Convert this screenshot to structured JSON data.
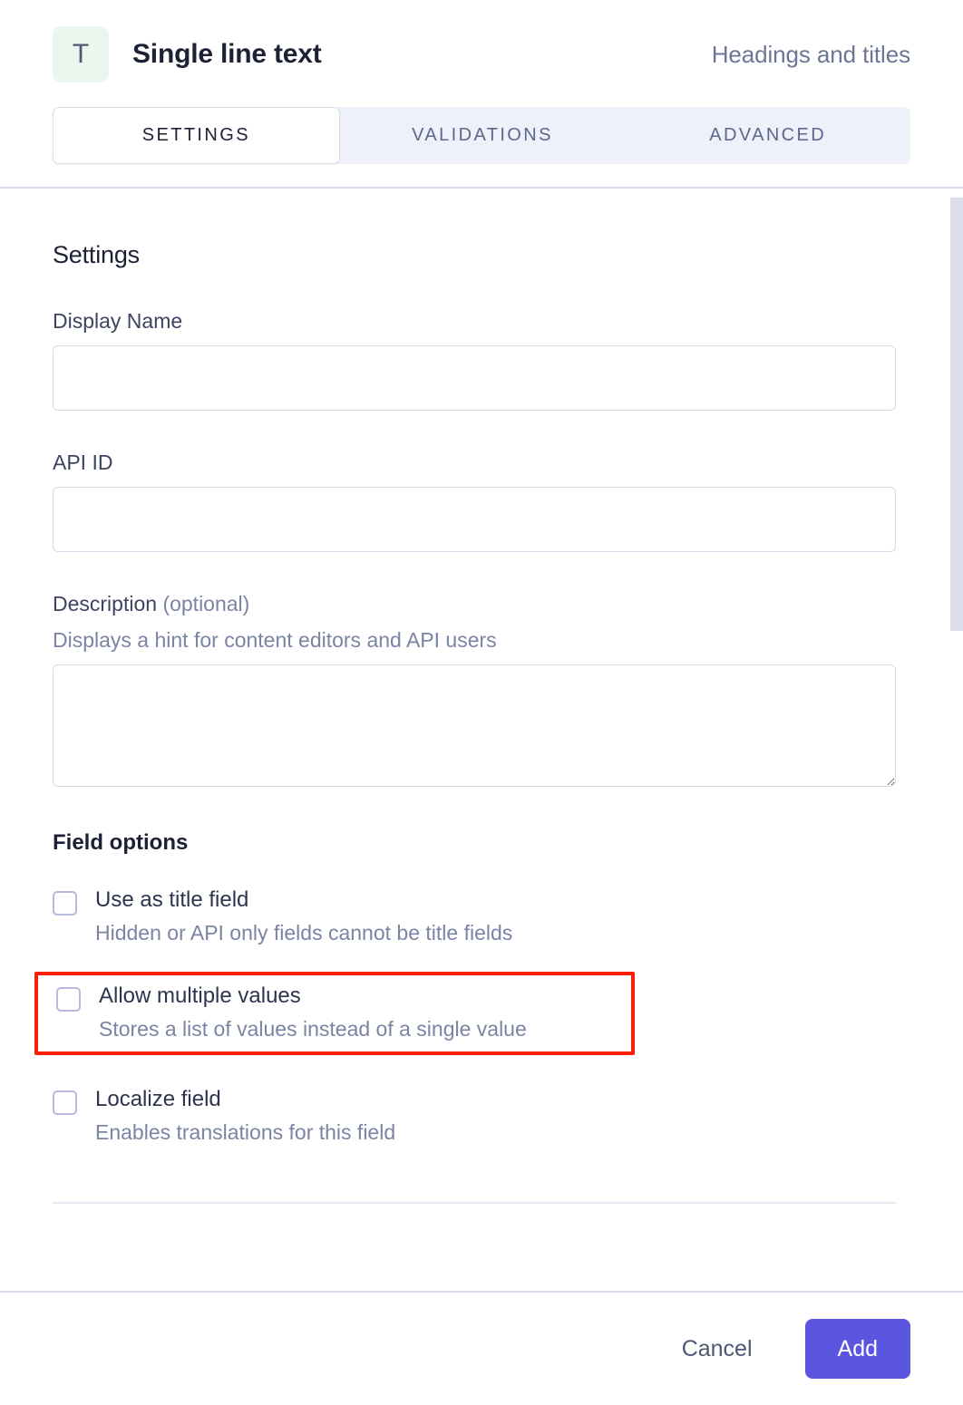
{
  "header": {
    "type_icon_glyph": "T",
    "type_icon_name": "single-line-text-icon",
    "title": "Single line text",
    "group": "Headings and titles"
  },
  "tabs": [
    {
      "label": "SETTINGS",
      "active": true
    },
    {
      "label": "VALIDATIONS",
      "active": false
    },
    {
      "label": "ADVANCED",
      "active": false
    }
  ],
  "settings": {
    "section_title": "Settings",
    "display_name": {
      "label": "Display Name",
      "value": "",
      "placeholder": ""
    },
    "api_id": {
      "label": "API ID",
      "value": "",
      "placeholder": ""
    },
    "description": {
      "label": "Description",
      "label_optional": "(optional)",
      "hint": "Displays a hint for content editors and API users",
      "value": "",
      "placeholder": ""
    },
    "field_options_title": "Field options",
    "options": [
      {
        "label": "Use as title field",
        "sub": "Hidden or API only fields cannot be title fields",
        "checked": false,
        "highlighted": false
      },
      {
        "label": "Allow multiple values",
        "sub": "Stores a list of values instead of a single value",
        "checked": false,
        "highlighted": true
      },
      {
        "label": "Localize field",
        "sub": "Enables translations for this field",
        "checked": false,
        "highlighted": false
      }
    ]
  },
  "footer": {
    "cancel_label": "Cancel",
    "add_label": "Add"
  },
  "colors": {
    "accent": "#5b56e0",
    "icon_background": "#e9f7ee",
    "annotation": "#fb1e09",
    "text_primary": "#1d2135",
    "text_muted": "#7b84a4",
    "tabbar_background": "#eef1f9",
    "border": "#d6d9e8"
  }
}
